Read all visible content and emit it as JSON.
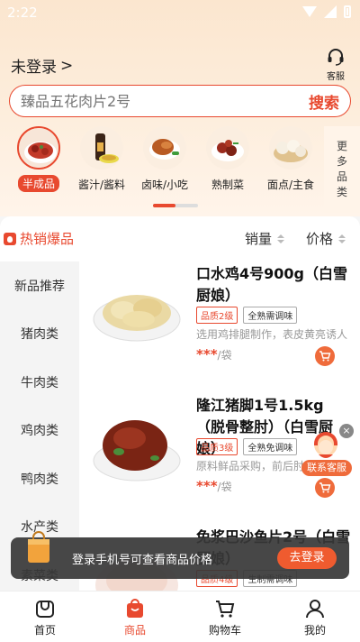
{
  "status_bar": {
    "time": "2:22"
  },
  "header": {
    "login_text": "未登录",
    "login_chevron": ">",
    "service_label": "客服"
  },
  "search": {
    "placeholder": "臻品五花肉片2号",
    "button": "搜索"
  },
  "categories": [
    {
      "label": "半成品",
      "icon": "braised-meat-plate",
      "active": true
    },
    {
      "label": "酱汁/酱料",
      "icon": "sauce-bottle"
    },
    {
      "label": "卤味/小吃",
      "icon": "roast-duck"
    },
    {
      "label": "熟制菜",
      "icon": "braised-dish"
    },
    {
      "label": "面点/主食",
      "icon": "steamed-buns"
    }
  ],
  "more_categories": [
    "更",
    "多",
    "品",
    "类"
  ],
  "sort_bar": {
    "hot_tab": "热销爆品",
    "sales": "销量",
    "price": "价格"
  },
  "side_nav": [
    "新品推荐",
    "猪肉类",
    "牛肉类",
    "鸡肉类",
    "鸭肉类",
    "水产类",
    "素菜类"
  ],
  "products": [
    {
      "name": "口水鸡4号900g（白雪厨娘）",
      "tags": [
        "品质2级",
        "全熟需调味"
      ],
      "desc": "选用鸡排腿制作，表皮黄亮诱人",
      "price": "***",
      "unit": "/袋"
    },
    {
      "name": "隆江猪脚1号1.5kg（脱骨整肘）（白雪厨娘）",
      "tags": [
        "品质3级",
        "全熟免调味"
      ],
      "desc": "原料鲜品采购，前后肘",
      "price": "***",
      "unit": "/袋"
    },
    {
      "name": "免浆巴沙鱼片2号（白雪厨娘）",
      "tags": [
        "品质4级",
        "生制需调味"
      ],
      "desc": "",
      "price": "",
      "unit": ""
    }
  ],
  "floating_service": {
    "close": "×",
    "label": "联系客服"
  },
  "login_toast": {
    "text": "登录手机号可查看商品价格",
    "button": "去登录"
  },
  "tabbar": [
    {
      "label": "首页",
      "icon": "home-icon"
    },
    {
      "label": "商品",
      "icon": "bag-icon",
      "active": true
    },
    {
      "label": "购物车",
      "icon": "cart-icon"
    },
    {
      "label": "我的",
      "icon": "user-icon"
    }
  ],
  "colors": {
    "accent": "#e8492f",
    "cart_button": "#ef6b3b",
    "header_bg": "#fbe6cf"
  }
}
